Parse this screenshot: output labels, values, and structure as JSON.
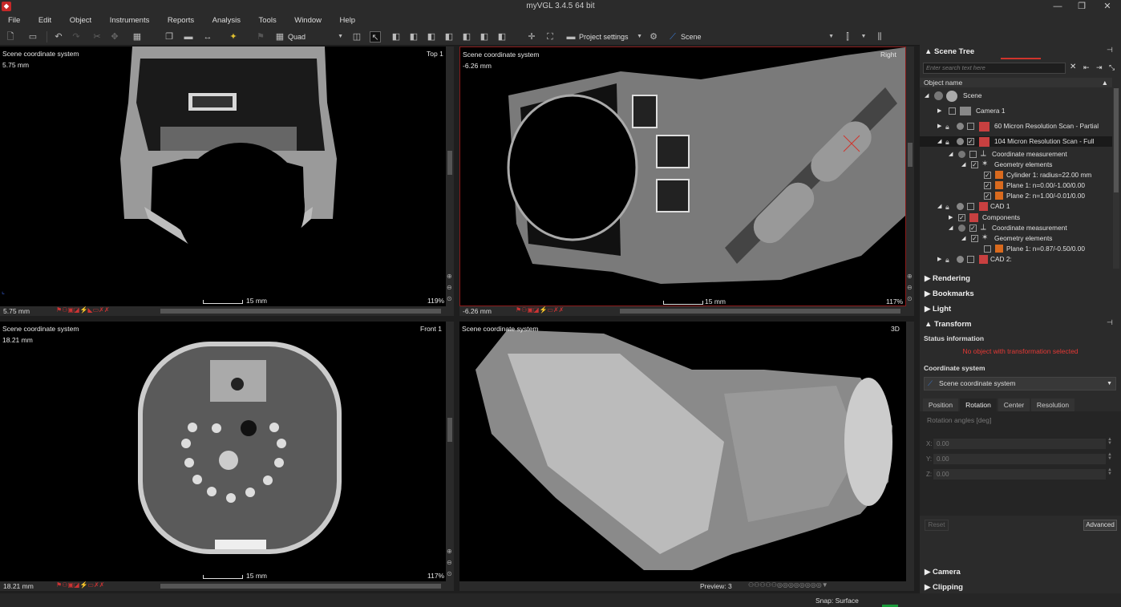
{
  "window": {
    "title": "myVGL 3.4.5 64 bit",
    "minimize": "—",
    "restore": "❐",
    "close": "✕"
  },
  "menu": [
    "File",
    "Edit",
    "Object",
    "Instruments",
    "Reports",
    "Analysis",
    "Tools",
    "Window",
    "Help"
  ],
  "toolbar": {
    "layout_value": "Quad",
    "project_settings_label": "Project settings",
    "scene_value": "Scene"
  },
  "viewports": {
    "top_left": {
      "coord_system": "Scene coordinate system",
      "depth": "5.75 mm",
      "view_name": "Top 1",
      "scale_label": "15 mm",
      "zoom": "119%",
      "bar_value": "5.75 mm"
    },
    "top_right": {
      "coord_system": "Scene coordinate system",
      "depth": "-6.26 mm",
      "view_name": "Right",
      "scale_label": "15 mm",
      "zoom": "117%",
      "bar_value": "-6.26 mm"
    },
    "bottom_left": {
      "coord_system": "Scene coordinate system",
      "depth": "18.21 mm",
      "view_name": "Front 1",
      "scale_label": "15 mm",
      "zoom": "117%",
      "bar_value": "18.21 mm"
    },
    "bottom_right": {
      "coord_system": "Scene coordinate system",
      "view_name": "3D",
      "preview": "Preview: 3"
    }
  },
  "scene_tree": {
    "header": "Scene Tree",
    "search_placeholder": "Enter search text here",
    "column_header": "Object name",
    "rows": [
      {
        "label": "Scene"
      },
      {
        "label": "Camera 1"
      },
      {
        "label": "60 Micron Resolution Scan - Partial"
      },
      {
        "label": "104 Micron Resolution Scan - Full"
      },
      {
        "label": "Coordinate measurement"
      },
      {
        "label": "Geometry elements"
      },
      {
        "label": "Cylinder 1: radius=22.00 mm"
      },
      {
        "label": "Plane 1: n=0.00/-1.00/0.00"
      },
      {
        "label": "Plane 2: n=1.00/-0.01/0.00"
      },
      {
        "label": "CAD 1"
      },
      {
        "label": "Components"
      },
      {
        "label": "Coordinate measurement"
      },
      {
        "label": "Geometry elements"
      },
      {
        "label": "Plane 1: n=0.87/-0.50/0.00"
      },
      {
        "label": "CAD 2:"
      }
    ]
  },
  "panels": {
    "rendering": "Rendering",
    "bookmarks": "Bookmarks",
    "light": "Light",
    "transform": "Transform",
    "camera": "Camera",
    "clipping": "Clipping"
  },
  "transform": {
    "status_heading": "Status information",
    "status_message": "No object with transformation selected",
    "coord_heading": "Coordinate system",
    "coord_value": "Scene coordinate system",
    "tabs": [
      "Position",
      "Rotation",
      "Center",
      "Resolution"
    ],
    "rotation_heading": "Rotation angles [deg]",
    "x_label": "X:",
    "x_value": "0.00",
    "y_label": "Y:",
    "y_value": "0.00",
    "z_label": "Z:",
    "z_value": "0.00",
    "reset_label": "Reset",
    "advanced_label": "Advanced"
  },
  "status": {
    "snap": "Snap: Surface"
  },
  "colors": {
    "accent_red": "#d0342c",
    "status_red": "#e53935"
  }
}
